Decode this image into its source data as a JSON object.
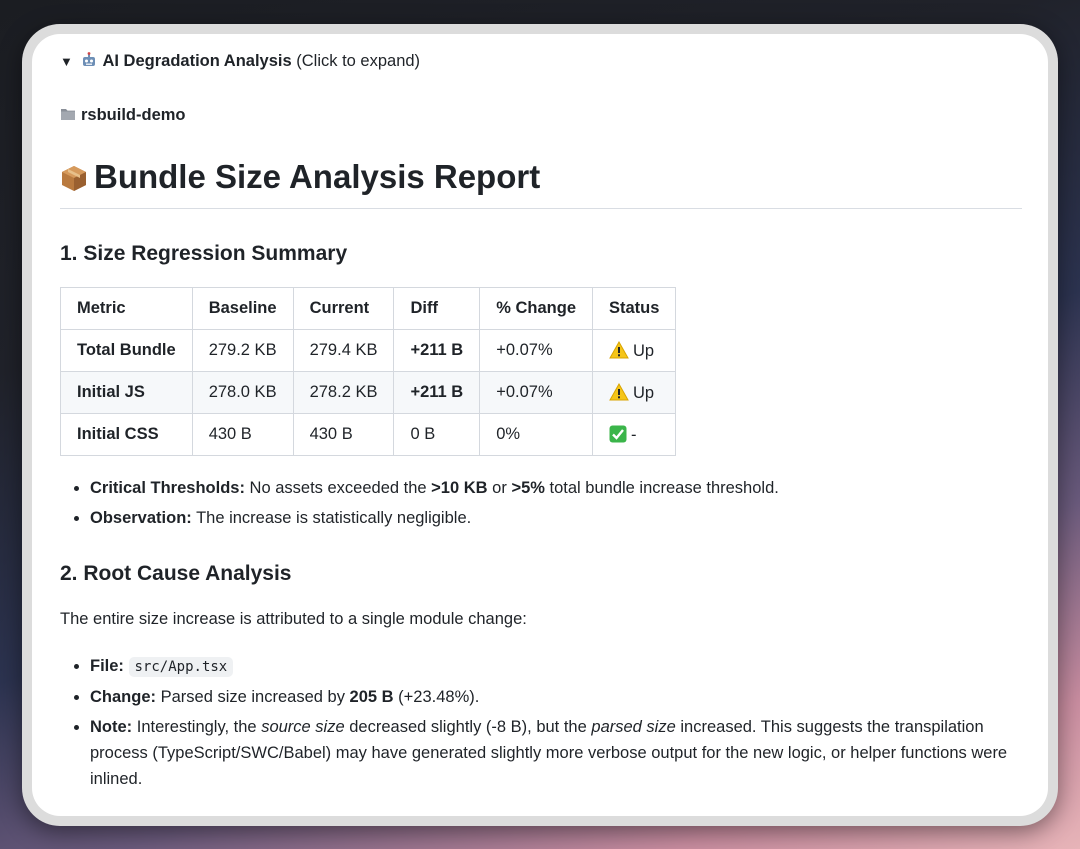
{
  "summary": {
    "triangle": "▼",
    "title": "AI Degradation Analysis",
    "hint": "(Click to expand)"
  },
  "project": {
    "name": "rsbuild-demo"
  },
  "report": {
    "title": "Bundle Size Analysis Report"
  },
  "section1": {
    "heading": "1. Size Regression Summary",
    "table": {
      "headers": [
        "Metric",
        "Baseline",
        "Current",
        "Diff",
        "% Change",
        "Status"
      ],
      "rows": [
        {
          "metric": "Total Bundle",
          "baseline": "279.2 KB",
          "current": "279.4 KB",
          "diff": "+211 B",
          "change": "+0.07%",
          "status": "Up",
          "status_icon": "warning-icon"
        },
        {
          "metric": "Initial JS",
          "baseline": "278.0 KB",
          "current": "278.2 KB",
          "diff": "+211 B",
          "change": "+0.07%",
          "status": "Up",
          "status_icon": "warning-icon"
        },
        {
          "metric": "Initial CSS",
          "baseline": "430 B",
          "current": "430 B",
          "diff": "0 B",
          "change": "0%",
          "status": "-",
          "status_icon": "check-icon"
        }
      ]
    },
    "bullets": {
      "thresholds_label": "Critical Thresholds:",
      "thresholds_text_1": "No assets exceeded the",
      "thresholds_bold_1": ">10 KB",
      "thresholds_text_2": "or",
      "thresholds_bold_2": ">5%",
      "thresholds_text_3": "total bundle increase threshold.",
      "observation_label": "Observation:",
      "observation_text": "The increase is statistically negligible."
    }
  },
  "section2": {
    "heading": "2. Root Cause Analysis",
    "intro": "The entire size increase is attributed to a single module change:",
    "file_label": "File:",
    "file_value": "src/App.tsx",
    "change_label": "Change:",
    "change_text_1": "Parsed size increased by",
    "change_bold": "205 B",
    "change_text_2": "(+23.48%).",
    "note_label": "Note:",
    "note_text_1": "Interestingly, the",
    "note_em_1": "source size",
    "note_text_2": "decreased slightly (-8 B), but the",
    "note_em_2": "parsed size",
    "note_text_3": "increased. This suggests the transpilation process (TypeScript/SWC/Babel) may have generated slightly more verbose output for the new logic, or helper functions were inlined."
  },
  "colors": {
    "text": "#1f2328",
    "border": "#d4d8de",
    "warning": "#f5c518",
    "check": "#3bb54a"
  }
}
